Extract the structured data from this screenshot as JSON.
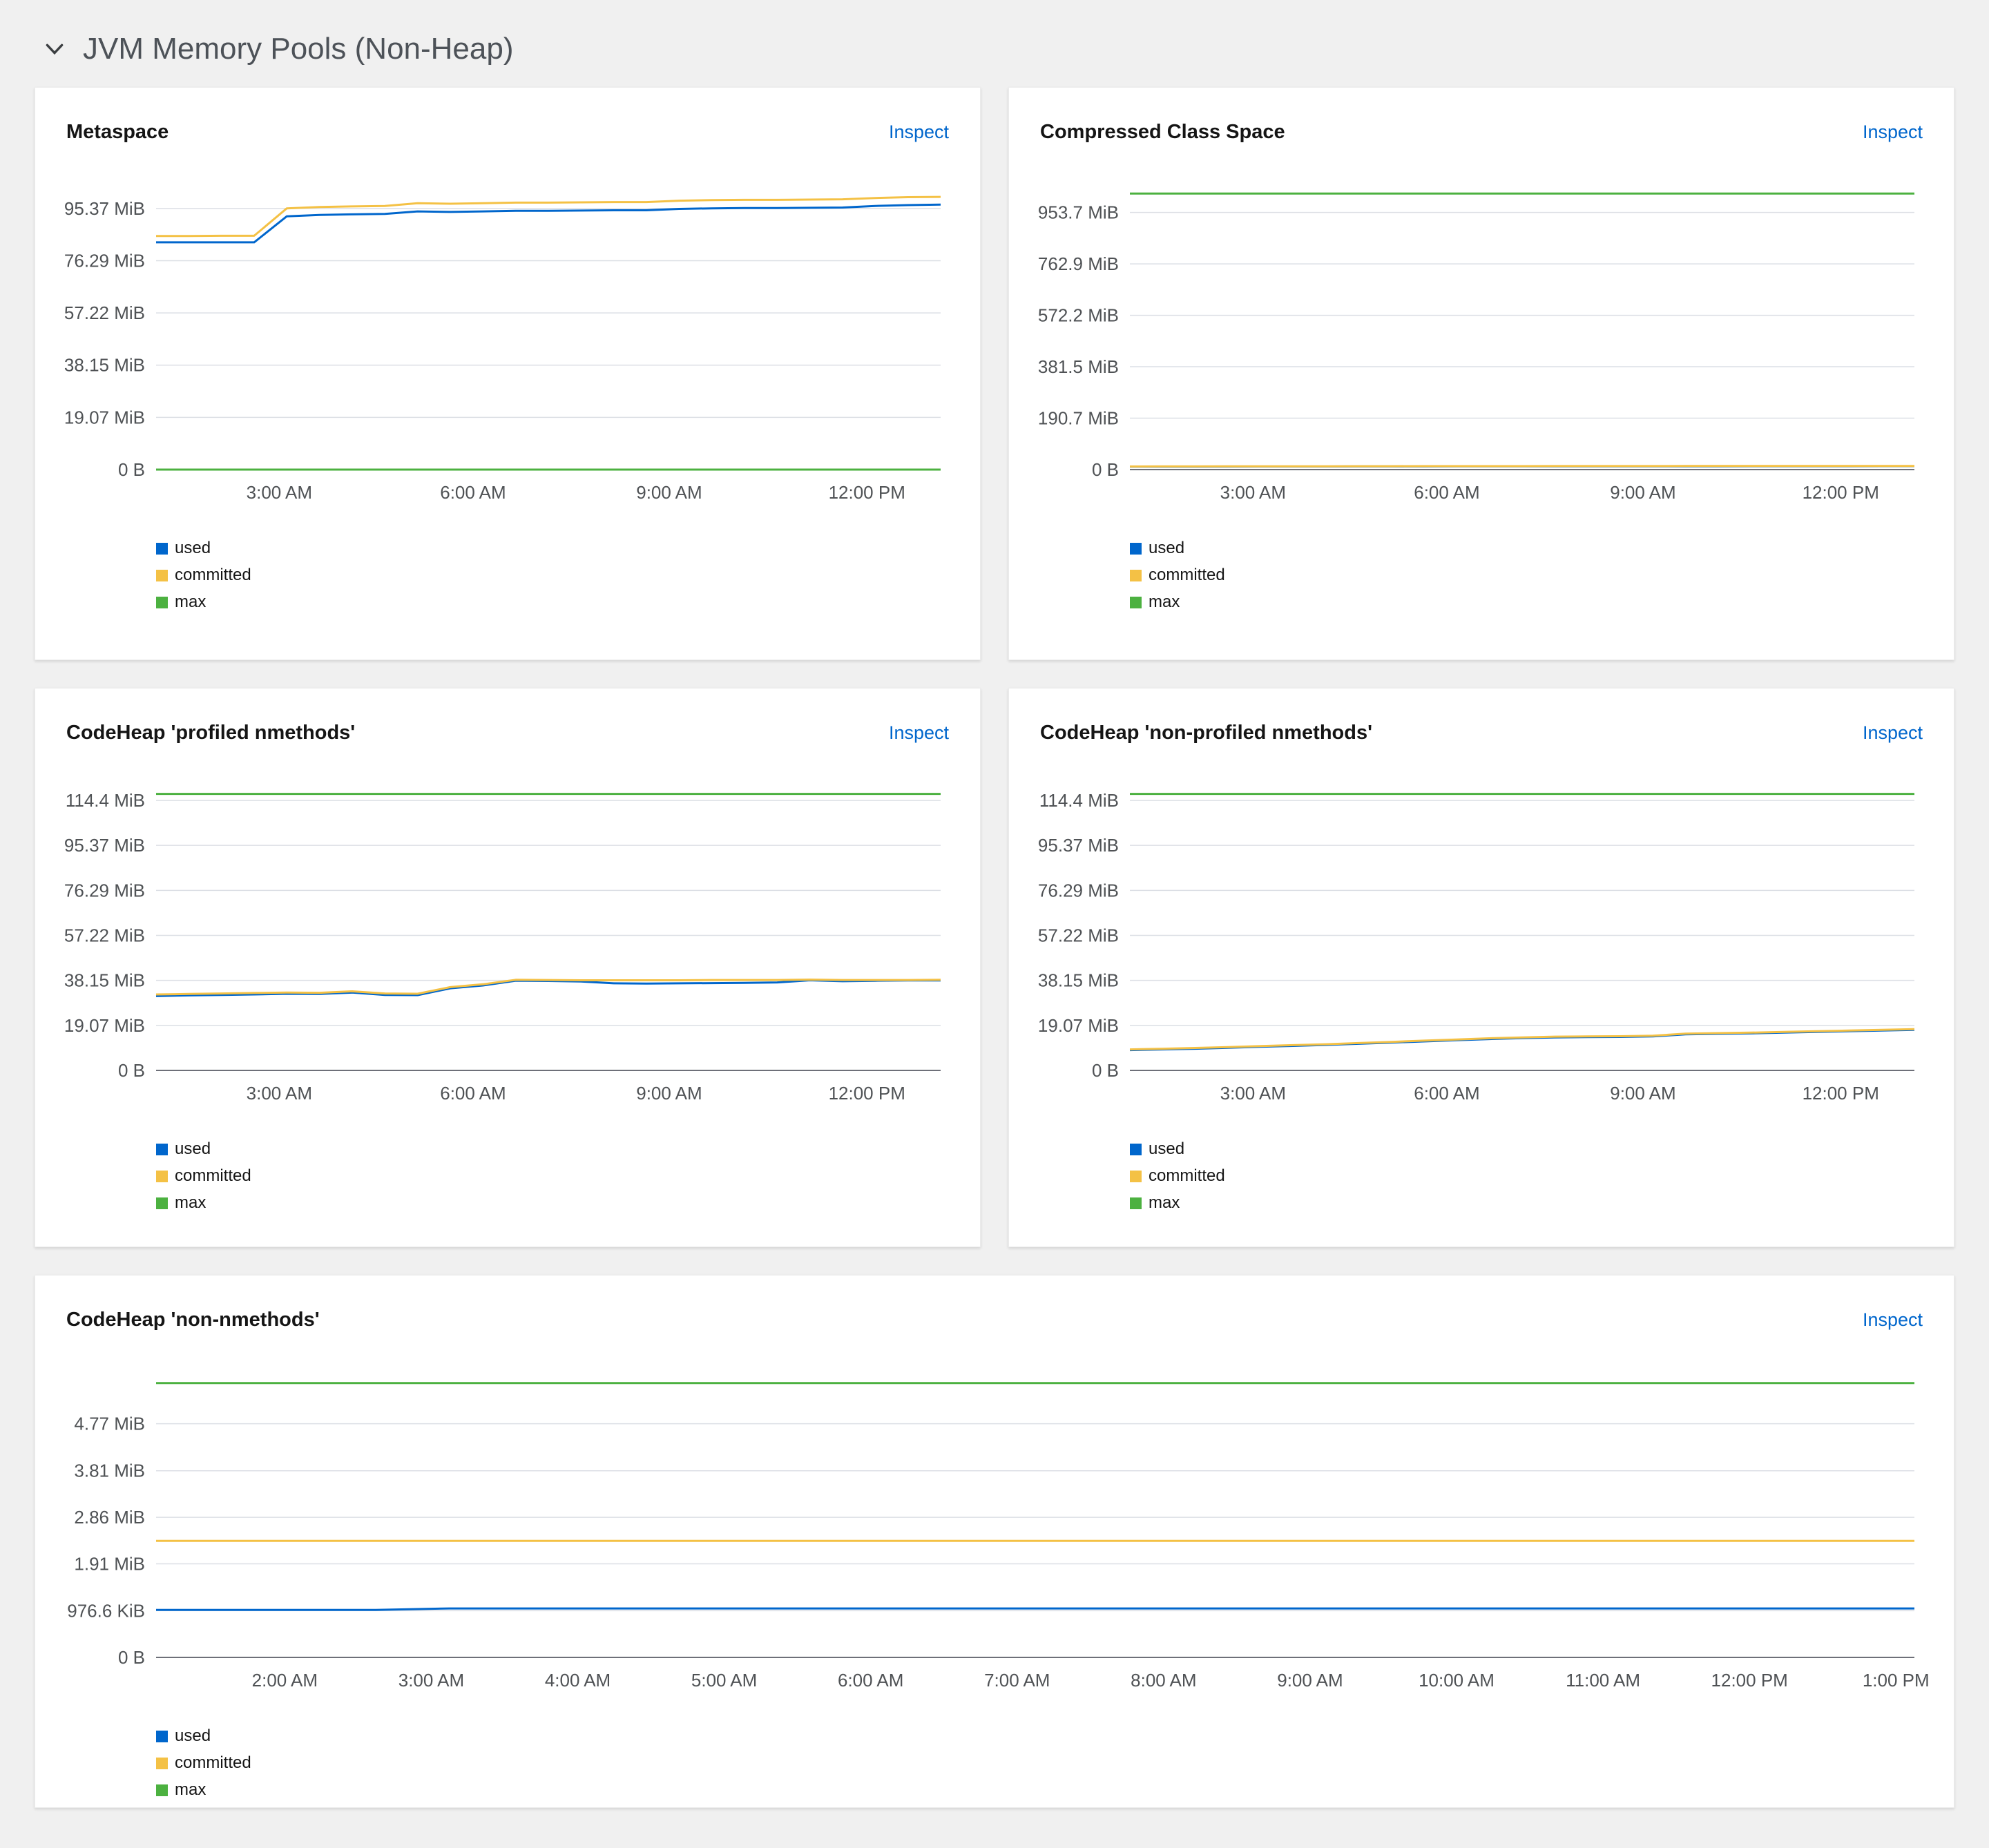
{
  "page": {
    "section": {
      "title": "JVM Memory Pools (Non-Heap)",
      "icon": "angle-down-icon",
      "expanded": true
    }
  },
  "colors": {
    "used": "#0066cc",
    "committed": "#f4c145",
    "max": "#4cb140",
    "link": "#0066cc",
    "axis": "#6e7079",
    "gridline": "#dcdfe5",
    "tick_text": "#4f5255"
  },
  "chart_data": [
    {
      "id": "metaspace",
      "type": "line",
      "title": "Metaspace",
      "inspect_label": "Inspect",
      "unit": "MiB",
      "grid": true,
      "legend_position": "bottom-left",
      "ylim": [
        0,
        103.4
      ],
      "y_ticks": [
        {
          "label": "95.37 MiB",
          "value": 95.37
        },
        {
          "label": "76.29 MiB",
          "value": 76.29
        },
        {
          "label": "57.22 MiB",
          "value": 57.22
        },
        {
          "label": "38.15 MiB",
          "value": 38.15
        },
        {
          "label": "19.07 MiB",
          "value": 19.07
        },
        {
          "label": "0 B",
          "value": 0
        }
      ],
      "x_ticks": [
        {
          "label": "3:00 AM",
          "f": 0.157
        },
        {
          "label": "6:00 AM",
          "f": 0.404
        },
        {
          "label": "9:00 AM",
          "f": 0.654
        },
        {
          "label": "12:00 PM",
          "f": 0.906
        }
      ],
      "series": [
        {
          "name": "used",
          "color": "#0066cc",
          "values": [
            83,
            83,
            83,
            83,
            92.5,
            93,
            93.2,
            93.4,
            94.3,
            94.1,
            94.3,
            94.5,
            94.5,
            94.6,
            94.7,
            94.7,
            95.2,
            95.4,
            95.5,
            95.5,
            95.6,
            95.7,
            96.3,
            96.6,
            96.8
          ]
        },
        {
          "name": "committed",
          "color": "#f4c145",
          "values": [
            85.3,
            85.3,
            85.4,
            85.4,
            95.4,
            95.9,
            96.1,
            96.3,
            97.3,
            97.1,
            97.3,
            97.5,
            97.5,
            97.6,
            97.7,
            97.7,
            98.2,
            98.4,
            98.5,
            98.5,
            98.6,
            98.7,
            99.2,
            99.5,
            99.6
          ]
        },
        {
          "name": "max",
          "color": "#4cb140",
          "values": [
            0,
            0
          ]
        }
      ]
    },
    {
      "id": "compressed-class-space",
      "type": "line",
      "title": "Compressed Class Space",
      "inspect_label": "Inspect",
      "unit": "MiB",
      "grid": true,
      "legend_position": "bottom-left",
      "ylim": [
        0,
        1050
      ],
      "y_ticks": [
        {
          "label": "953.7 MiB",
          "value": 953.7
        },
        {
          "label": "762.9 MiB",
          "value": 762.9
        },
        {
          "label": "572.2 MiB",
          "value": 572.2
        },
        {
          "label": "381.5 MiB",
          "value": 381.5
        },
        {
          "label": "190.7 MiB",
          "value": 190.7
        },
        {
          "label": "0 B",
          "value": 0
        }
      ],
      "x_ticks": [
        {
          "label": "3:00 AM",
          "f": 0.157
        },
        {
          "label": "6:00 AM",
          "f": 0.404
        },
        {
          "label": "9:00 AM",
          "f": 0.654
        },
        {
          "label": "12:00 PM",
          "f": 0.906
        }
      ],
      "series": [
        {
          "name": "used",
          "color": "#0066cc",
          "values": [
            10.8,
            10.9,
            11.1,
            11.2,
            11.4,
            11.5,
            11.6,
            11.7,
            11.8,
            11.9,
            12,
            12,
            12.1,
            12.2,
            12.2,
            12.3,
            12.3,
            12.4,
            12.4,
            12.5,
            12.5,
            12.6,
            12.6,
            12.7,
            12.7
          ]
        },
        {
          "name": "committed",
          "color": "#f4c145",
          "values": [
            11.6,
            11.7,
            11.9,
            12,
            12.2,
            12.3,
            12.4,
            12.5,
            12.6,
            12.7,
            12.8,
            12.8,
            12.9,
            13,
            13,
            13.1,
            13.1,
            13.2,
            13.2,
            13.3,
            13.3,
            13.4,
            13.4,
            13.5,
            13.5
          ]
        },
        {
          "name": "max",
          "color": "#4cb140",
          "values": [
            1024,
            1024
          ]
        }
      ]
    },
    {
      "id": "codeheap-profiled-nmethods",
      "type": "line",
      "title": "CodeHeap 'profiled nmethods'",
      "inspect_label": "Inspect",
      "unit": "MiB",
      "grid": true,
      "legend_position": "bottom-left",
      "ylim": [
        0,
        120
      ],
      "y_ticks": [
        {
          "label": "114.4 MiB",
          "value": 114.4
        },
        {
          "label": "95.37 MiB",
          "value": 95.37
        },
        {
          "label": "76.29 MiB",
          "value": 76.29
        },
        {
          "label": "57.22 MiB",
          "value": 57.22
        },
        {
          "label": "38.15 MiB",
          "value": 38.15
        },
        {
          "label": "19.07 MiB",
          "value": 19.07
        },
        {
          "label": "0 B",
          "value": 0
        }
      ],
      "x_ticks": [
        {
          "label": "3:00 AM",
          "f": 0.157
        },
        {
          "label": "6:00 AM",
          "f": 0.404
        },
        {
          "label": "9:00 AM",
          "f": 0.654
        },
        {
          "label": "12:00 PM",
          "f": 0.906
        }
      ],
      "series": [
        {
          "name": "used",
          "color": "#0066cc",
          "values": [
            31.5,
            31.8,
            32,
            32.2,
            32.5,
            32.4,
            33,
            32,
            31.9,
            34.8,
            36,
            38,
            37.9,
            37.7,
            36.9,
            36.8,
            36.9,
            37,
            37.1,
            37.3,
            38.2,
            37.8,
            38,
            38.1,
            38.15
          ]
        },
        {
          "name": "committed",
          "color": "#f4c145",
          "values": [
            32.2,
            32.4,
            32.6,
            32.8,
            33,
            32.9,
            33.5,
            32.6,
            32.5,
            35.3,
            36.5,
            38.4,
            38.3,
            38.2,
            38.2,
            38.2,
            38.2,
            38.3,
            38.3,
            38.3,
            38.5,
            38.3,
            38.3,
            38.3,
            38.4
          ]
        },
        {
          "name": "max",
          "color": "#4cb140",
          "values": [
            117.2,
            117.2
          ]
        }
      ]
    },
    {
      "id": "codeheap-non-profiled-nmethods",
      "type": "line",
      "title": "CodeHeap 'non-profiled nmethods'",
      "inspect_label": "Inspect",
      "unit": "MiB",
      "grid": true,
      "legend_position": "bottom-left",
      "ylim": [
        0,
        120
      ],
      "y_ticks": [
        {
          "label": "114.4 MiB",
          "value": 114.4
        },
        {
          "label": "95.37 MiB",
          "value": 95.37
        },
        {
          "label": "76.29 MiB",
          "value": 76.29
        },
        {
          "label": "57.22 MiB",
          "value": 57.22
        },
        {
          "label": "38.15 MiB",
          "value": 38.15
        },
        {
          "label": "19.07 MiB",
          "value": 19.07
        },
        {
          "label": "0 B",
          "value": 0
        }
      ],
      "x_ticks": [
        {
          "label": "3:00 AM",
          "f": 0.157
        },
        {
          "label": "6:00 AM",
          "f": 0.404
        },
        {
          "label": "9:00 AM",
          "f": 0.654
        },
        {
          "label": "12:00 PM",
          "f": 0.906
        }
      ],
      "series": [
        {
          "name": "used",
          "color": "#0066cc",
          "values": [
            8.6,
            8.9,
            9.2,
            9.6,
            10,
            10.4,
            10.8,
            11.3,
            11.8,
            12.3,
            12.8,
            13.3,
            13.7,
            14,
            14.1,
            14.2,
            14.4,
            15.3,
            15.5,
            15.7,
            16,
            16.3,
            16.6,
            16.9,
            17.2
          ]
        },
        {
          "name": "committed",
          "color": "#f4c145",
          "values": [
            8.9,
            9.2,
            9.5,
            9.9,
            10.3,
            10.7,
            11.1,
            11.6,
            12.1,
            12.6,
            13.1,
            13.6,
            14,
            14.3,
            14.4,
            14.5,
            14.7,
            15.6,
            15.8,
            16,
            16.3,
            16.6,
            16.9,
            17.2,
            17.5
          ]
        },
        {
          "name": "max",
          "color": "#4cb140",
          "values": [
            117.2,
            117.2
          ]
        }
      ]
    },
    {
      "id": "codeheap-non-nmethods",
      "type": "line",
      "title": "CodeHeap 'non-nmethods'",
      "inspect_label": "Inspect",
      "unit": "MiB",
      "grid": true,
      "legend_position": "bottom-left",
      "ylim": [
        0,
        5.78
      ],
      "y_ticks": [
        {
          "label": "4.77 MiB",
          "value": 4.77
        },
        {
          "label": "3.81 MiB",
          "value": 3.81
        },
        {
          "label": "2.86 MiB",
          "value": 2.86
        },
        {
          "label": "1.91 MiB",
          "value": 1.91
        },
        {
          "label": "976.6 KiB",
          "value": 0.9537
        },
        {
          "label": "0 B",
          "value": 0
        }
      ],
      "x_ticks": [
        {
          "label": "2:00 AM",
          "f": 0.0732
        },
        {
          "label": "3:00 AM",
          "f": 0.1565
        },
        {
          "label": "4:00 AM",
          "f": 0.2398
        },
        {
          "label": "5:00 AM",
          "f": 0.3231
        },
        {
          "label": "6:00 AM",
          "f": 0.4064
        },
        {
          "label": "7:00 AM",
          "f": 0.4897
        },
        {
          "label": "8:00 AM",
          "f": 0.573
        },
        {
          "label": "9:00 AM",
          "f": 0.6563
        },
        {
          "label": "10:00 AM",
          "f": 0.7396
        },
        {
          "label": "11:00 AM",
          "f": 0.8229
        },
        {
          "label": "12:00 PM",
          "f": 0.9062
        },
        {
          "label": "1:00 PM",
          "f": 0.9895
        }
      ],
      "series": [
        {
          "name": "used",
          "color": "#0066cc",
          "values": [
            0.97,
            0.97,
            0.97,
            0.97,
            1,
            1,
            1,
            1,
            1,
            1,
            1,
            1,
            1,
            1,
            1,
            1,
            1,
            1,
            1,
            1,
            1,
            1,
            1,
            1,
            1
          ]
        },
        {
          "name": "committed",
          "color": "#f4c145",
          "values": [
            2.38,
            2.38
          ]
        },
        {
          "name": "max",
          "color": "#4cb140",
          "values": [
            5.6,
            5.6
          ]
        }
      ]
    }
  ]
}
